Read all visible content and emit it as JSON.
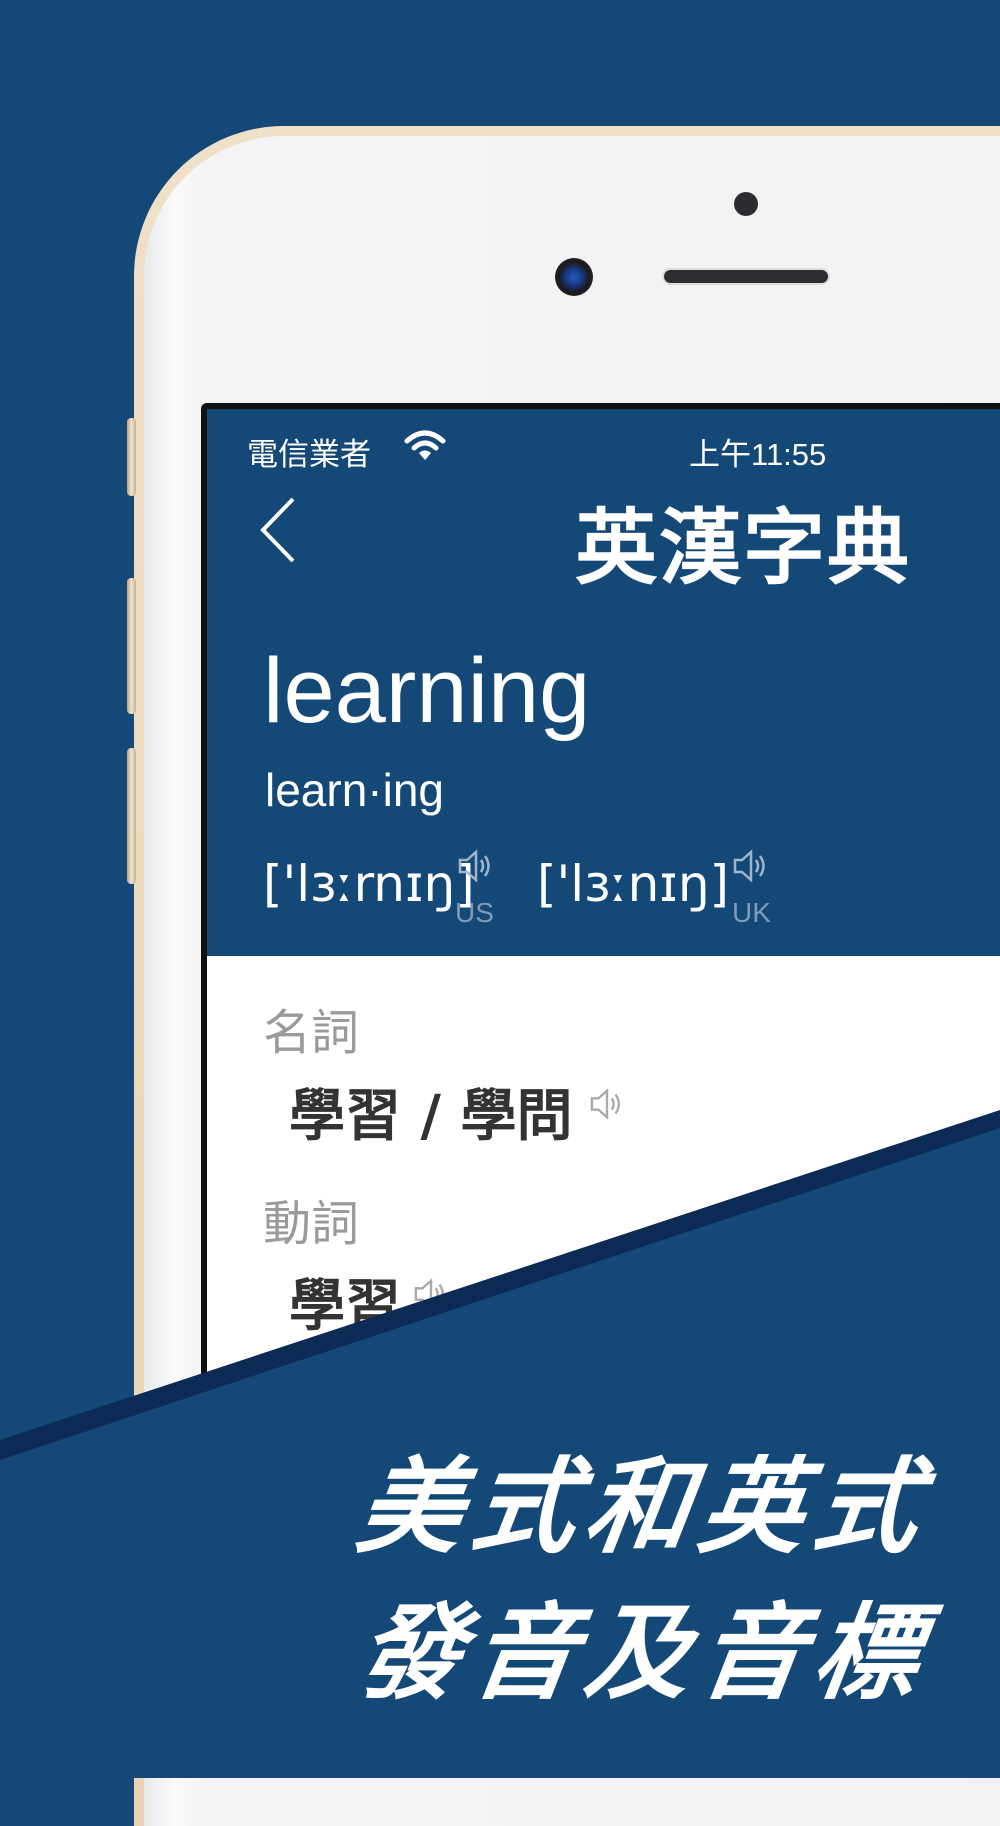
{
  "status_bar": {
    "carrier": "電信業者",
    "wifi_icon": "wifi-icon",
    "time": "上午11:55"
  },
  "nav": {
    "back_icon": "chevron-left-icon",
    "title": "英漢字典"
  },
  "entry": {
    "word": "learning",
    "syllables": "learn·ing",
    "pronunciations": [
      {
        "ipa": "['lɜːrnɪŋ]",
        "region": "US",
        "icon": "speaker-icon"
      },
      {
        "ipa": "['lɜːnɪŋ]",
        "region": "UK",
        "icon": "speaker-icon"
      }
    ],
    "senses": [
      {
        "pos": "名詞",
        "definition": "學習 / 學問",
        "icon": "speaker-icon"
      },
      {
        "pos": "動詞",
        "definition": "學習",
        "icon": "speaker-icon"
      }
    ]
  },
  "promo": {
    "line1": "美式和英式",
    "line2": "發音及音標"
  },
  "colors": {
    "brand_blue": "#144877",
    "dark_stripe": "#0b2a54",
    "phone_gold": "#efe0c8"
  }
}
